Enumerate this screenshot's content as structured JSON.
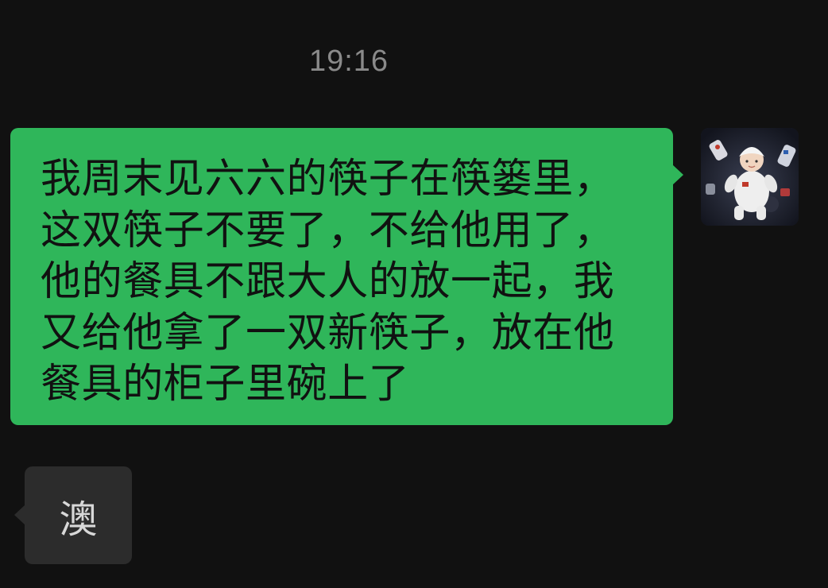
{
  "chat": {
    "timestamp": "19:16",
    "messages": [
      {
        "direction": "outgoing",
        "text": "我周末见六六的筷子在筷篓里，这双筷子不要了，不给他用了，他的餐具不跟大人的放一起，我又给他拿了一双新筷子，放在他餐具的柜子里碗上了",
        "bubble_color": "#2fb65a",
        "avatar_icon": "baby-photo-avatar"
      },
      {
        "direction": "incoming",
        "text": "澳",
        "bubble_color": "#2c2c2c"
      }
    ]
  },
  "colors": {
    "background": "#111111",
    "timestamp": "#8a8a8a",
    "outgoing_text": "#111111",
    "incoming_text": "#d8d8d8"
  }
}
